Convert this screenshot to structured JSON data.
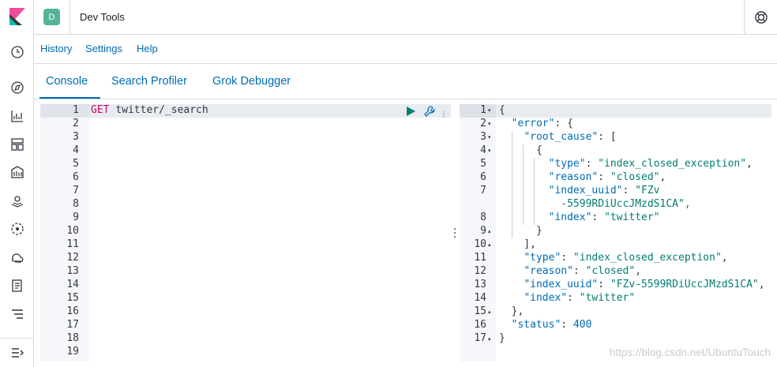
{
  "header": {
    "avatar_letter": "D",
    "title": "Dev Tools"
  },
  "topnav": {
    "items": [
      "History",
      "Settings",
      "Help"
    ]
  },
  "tabs": [
    "Console",
    "Search Profiler",
    "Grok Debugger"
  ],
  "request": {
    "method": "GET",
    "path": "twitter/_search",
    "line_numbers": [
      "1",
      "2",
      "3",
      "4",
      "5",
      "6",
      "7",
      "8",
      "9",
      "10",
      "11",
      "12",
      "13",
      "14",
      "15",
      "16",
      "17",
      "18",
      "19"
    ]
  },
  "response": {
    "lines": [
      {
        "n": "1",
        "fold": "▾",
        "t": "{"
      },
      {
        "n": "2",
        "fold": "▾",
        "t": "  \"error\": {"
      },
      {
        "n": "3",
        "fold": "▾",
        "t": "    \"root_cause\": ["
      },
      {
        "n": "4",
        "fold": "▾",
        "t": "      {"
      },
      {
        "n": "5",
        "fold": "",
        "t": "        \"type\": \"index_closed_exception\","
      },
      {
        "n": "6",
        "fold": "",
        "t": "        \"reason\": \"closed\","
      },
      {
        "n": "7",
        "fold": "",
        "t": "        \"index_uuid\": \"FZv"
      },
      {
        "n": "",
        "fold": "",
        "t": "          -5599RDiUccJMzdS1CA\","
      },
      {
        "n": "8",
        "fold": "",
        "t": "        \"index\": \"twitter\""
      },
      {
        "n": "9",
        "fold": "▴",
        "t": "      }"
      },
      {
        "n": "10",
        "fold": "▴",
        "t": "    ],"
      },
      {
        "n": "11",
        "fold": "",
        "t": "    \"type\": \"index_closed_exception\","
      },
      {
        "n": "12",
        "fold": "",
        "t": "    \"reason\": \"closed\","
      },
      {
        "n": "13",
        "fold": "",
        "t": "    \"index_uuid\": \"FZv-5599RDiUccJMzdS1CA\","
      },
      {
        "n": "14",
        "fold": "",
        "t": "    \"index\": \"twitter\""
      },
      {
        "n": "15",
        "fold": "▴",
        "t": "  },"
      },
      {
        "n": "16",
        "fold": "",
        "t": "  \"status\": 400"
      },
      {
        "n": "17",
        "fold": "▴",
        "t": "}"
      }
    ]
  },
  "watermark": "https://blog.csdn.net/UbuntuTouch",
  "colors": {
    "accent": "#006bb4",
    "avatar": "#54b399",
    "method": "#c80a68",
    "string": "#017d73"
  },
  "sidebar_icons": [
    "clock-icon",
    "compass-icon",
    "visualize-icon",
    "dashboard-icon",
    "canvas-icon",
    "maps-icon",
    "ml-icon",
    "infra-icon",
    "logs-icon",
    "apm-icon"
  ]
}
